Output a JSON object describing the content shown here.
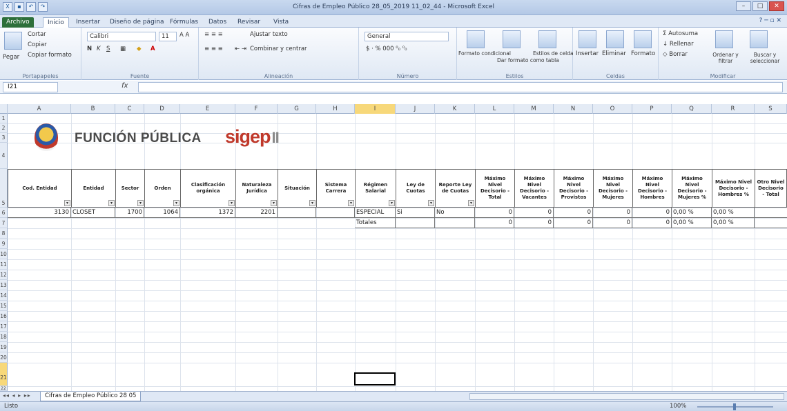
{
  "window": {
    "title": "Cifras de Empleo Público 28_05_2019 11_02_44 - Microsoft Excel"
  },
  "tabs": [
    "Archivo",
    "Inicio",
    "Insertar",
    "Diseño de página",
    "Fórmulas",
    "Datos",
    "Revisar",
    "Vista"
  ],
  "ribbon": {
    "clipboard": {
      "label": "Portapapeles",
      "paste": "Pegar",
      "cut": "Cortar",
      "copy": "Copiar",
      "format_painter": "Copiar formato"
    },
    "font": {
      "label": "Fuente",
      "name": "Calibri",
      "size": "11"
    },
    "alignment": {
      "label": "Alineación",
      "wrap": "Ajustar texto",
      "merge": "Combinar y centrar"
    },
    "number": {
      "label": "Número",
      "format": "General"
    },
    "styles": {
      "label": "Estilos",
      "conditional": "Formato condicional",
      "as_table": "Dar formato como tabla",
      "cell_styles": "Estilos de celda"
    },
    "cells": {
      "label": "Celdas",
      "insert": "Insertar",
      "delete": "Eliminar",
      "format": "Formato"
    },
    "editing": {
      "label": "Modificar",
      "autosum": "Autosuma",
      "fill": "Rellenar",
      "clear": "Borrar",
      "sort": "Ordenar y filtrar",
      "find": "Buscar y seleccionar"
    }
  },
  "formula_bar": {
    "name_box": "I21",
    "fx": "fx",
    "value": ""
  },
  "columns": [
    "A",
    "B",
    "C",
    "D",
    "E",
    "F",
    "G",
    "H",
    "I",
    "J",
    "K",
    "L",
    "M",
    "N",
    "O",
    "P",
    "Q",
    "R",
    "S"
  ],
  "rows": [
    "1",
    "2",
    "3",
    "4",
    "5",
    "6",
    "7",
    "8",
    "9",
    "10",
    "11",
    "12",
    "13",
    "14",
    "15",
    "16",
    "17",
    "18",
    "19",
    "20",
    "21",
    "22"
  ],
  "banner": {
    "org": "FUNCIÓN PÚBLICA",
    "brand": "sigep",
    "brand_suffix": "II"
  },
  "table": {
    "headers": [
      "Cod. Entidad",
      "Entidad",
      "Sector",
      "Orden",
      "Clasificación orgánica",
      "Naturaleza Jurídica",
      "Situación",
      "Sistema Carrera",
      "Régimen Salarial",
      "Ley de Cuotas",
      "Reporte Ley de Cuotas",
      "Máximo Nivel Decisorio - Total",
      "Máximo Nivel Decisorio - Vacantes",
      "Máximo Nivel Decisorio - Provistos",
      "Máximo Nivel Decisorio - Mujeres",
      "Máximo Nivel Decisorio - Hombres",
      "Máximo Nivel Decisorio - Mujeres %",
      "Máximo Nivel Decisorio - Hombres %",
      "Otro Nivel Decisorio - Total"
    ],
    "row6": [
      "3130",
      "CLOSET",
      "1700",
      "1064",
      "1372",
      "2201",
      "",
      "",
      "ESPECIAL",
      "Si",
      "No",
      "0",
      "0",
      "0",
      "0",
      "0",
      "0,00 %",
      "0,00 %",
      ""
    ],
    "row7": [
      "",
      "",
      "",
      "",
      "",
      "",
      "",
      "",
      "Totales",
      "",
      "",
      "0",
      "0",
      "0",
      "0",
      "0",
      "0,00 %",
      "0,00 %",
      ""
    ]
  },
  "sheet_tab": "Cifras de Empleo Público 28 05",
  "status": {
    "ready": "Listo",
    "zoom": "100%"
  }
}
